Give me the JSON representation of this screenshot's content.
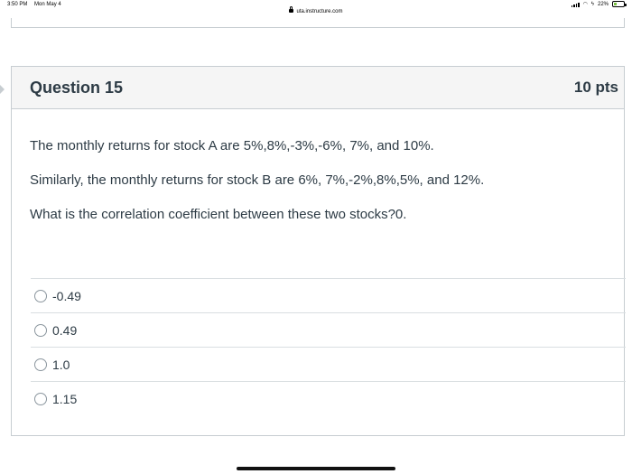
{
  "status_bar": {
    "time": "3:50 PM",
    "date": "Mon May 4",
    "battery": "22%"
  },
  "browser": {
    "url": "uta.instructure.com"
  },
  "question": {
    "title": "Question 15",
    "points": "10 pts",
    "paragraphs": [
      "The monthly returns for stock A are 5%,8%,-3%,-6%, 7%, and 10%.",
      "Similarly, the monthly returns for stock B are 6%, 7%,-2%,8%,5%, and 12%.",
      "What is the correlation coefficient between these two stocks?0."
    ],
    "answers": [
      {
        "label": "-0.49"
      },
      {
        "label": "0.49"
      },
      {
        "label": "1.0"
      },
      {
        "label": "1.15"
      }
    ]
  }
}
